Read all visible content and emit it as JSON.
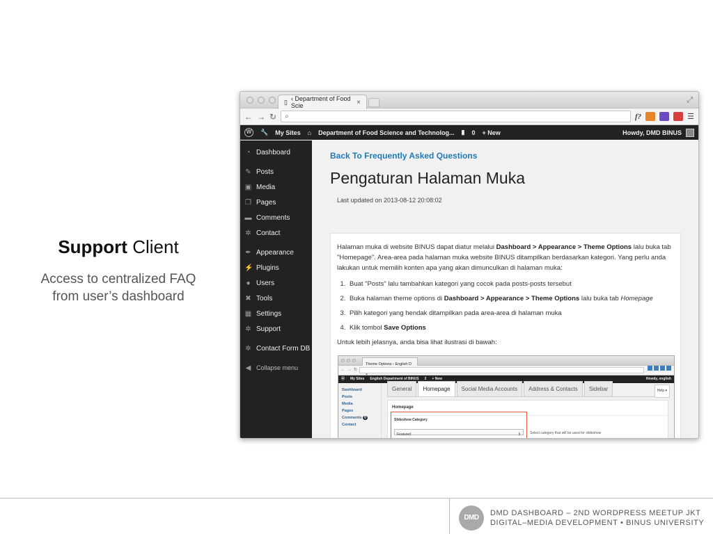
{
  "slide": {
    "heading_bold": "Support",
    "heading_light": " Client",
    "subtitle_line1": "Access to centralized FAQ",
    "subtitle_line2": "from user’s dashboard"
  },
  "browser": {
    "tab_title": "‹ Department of Food Scie",
    "tab_close": "×",
    "url": "",
    "ext_fx": "f?"
  },
  "adminbar": {
    "my_sites": "My Sites",
    "site_name": "Department of Food Science and Technolog...",
    "comments_count": "0",
    "new_label": "+ New",
    "howdy": "Howdy, DMD BINUS"
  },
  "sidebar": {
    "items": [
      {
        "label": "Dashboard"
      },
      {
        "label": "Posts"
      },
      {
        "label": "Media"
      },
      {
        "label": "Pages"
      },
      {
        "label": "Comments"
      },
      {
        "label": "Contact"
      },
      {
        "label": "Appearance"
      },
      {
        "label": "Plugins"
      },
      {
        "label": "Users"
      },
      {
        "label": "Tools"
      },
      {
        "label": "Settings"
      },
      {
        "label": "Support"
      },
      {
        "label": "Contact Form DB"
      },
      {
        "label": "Collapse menu"
      }
    ]
  },
  "content": {
    "back_link": "Back To Frequently Asked Questions",
    "title": "Pengaturan Halaman Muka",
    "updated": "Last updated on 2013-08-12 20:08:02",
    "intro_a": "Halaman muka di website BINUS dapat diatur melalui ",
    "intro_b": "Dashboard > Appearance > Theme Options",
    "intro_c": " lalu buka tab \"Homepage\". Area-area pada halaman muka website BINUS ditampilkan berdasarkan kategori. Yang perlu anda lakukan untuk memilih konten apa yang akan dimunculkan di halaman muka:",
    "step1": "Buat \"Posts\" lalu tambahkan kategori yang cocok pada posts-posts tersebut",
    "step2_a": "Buka halaman theme options di ",
    "step2_b": "Dashboard > Appearance > Theme Options",
    "step2_c": " lalu buka tab ",
    "step2_d": "Homepage",
    "step3": "Pilih kategori yang hendak ditampilkan pada area-area di halaman muka",
    "step4_a": "Klik tombol ",
    "step4_b": "Save Options",
    "outro": "Untuk lebih jelasnya, anda bisa lihat ilustrasi di bawah:"
  },
  "mini": {
    "tab_title": "Theme Options ‹ English D ×",
    "admin_my_sites": "My Sites",
    "admin_site": "English Department of BINUS",
    "admin_comments": "2",
    "admin_new": "+ New",
    "admin_howdy": "Howdy, english",
    "side": [
      "Dashboard",
      "Posts",
      "Media",
      "Pages",
      "Comments",
      "Contact"
    ],
    "comments_badge": "0",
    "tabs": [
      "General",
      "Homepage",
      "Social Media Accounts",
      "Address & Contacts",
      "Sidebar"
    ],
    "help": "Help ▾",
    "panel_title": "Homepage",
    "highlight_title": "Slideshow Category",
    "select_value": "Featured",
    "select_arrow": "⇕",
    "note": "Select category that will be used for slideshow"
  },
  "footer": {
    "logo": "DMD",
    "line1": "DMD DASHBOARD – 2ND WORDPRESS MEETUP JKT",
    "line2": "DIGITAL–MEDIA DEVELOPMENT • BINUS UNIVERSITY"
  },
  "colors": {
    "link": "#2179b5",
    "admin_bg": "#222222",
    "highlight": "#e05a45"
  }
}
